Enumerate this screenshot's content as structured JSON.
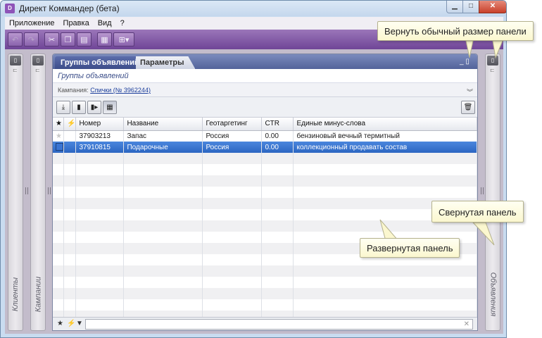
{
  "window": {
    "title": "Директ Коммандер (бета)",
    "app_icon_glyph": "D",
    "minimize": "▁",
    "maximize": "□",
    "close": "✕"
  },
  "menu": [
    "Приложение",
    "Правка",
    "Вид",
    "?"
  ],
  "toolbar": {
    "buttons": [
      {
        "icon": "undo-icon",
        "glyph": "↶",
        "enabled": false
      },
      {
        "icon": "redo-icon",
        "glyph": "↷",
        "enabled": false
      },
      {
        "icon": "cut-icon",
        "glyph": "✂",
        "enabled": true
      },
      {
        "icon": "copy-icon",
        "glyph": "❐",
        "enabled": true
      },
      {
        "icon": "clipboard-icon",
        "glyph": "▤",
        "enabled": true
      },
      {
        "icon": "table-icon",
        "glyph": "▦",
        "enabled": true
      },
      {
        "icon": "layout-icon",
        "glyph": "⊞▾",
        "enabled": true
      }
    ]
  },
  "side_panels": {
    "clients": "Клиенты",
    "campaigns": "Кампании",
    "ads": "Объявления"
  },
  "panel": {
    "tabs": [
      "Группы объявлений",
      "Параметры"
    ],
    "subtitle": "Группы объявлений",
    "campaign_label": "Кампания:",
    "campaign_link": "Спички (№ 3962244)",
    "controls": "_ ▯"
  },
  "grid": {
    "columns": [
      "★",
      "⚡",
      "Номер",
      "Название",
      "Геотаргетинг",
      "CTR",
      "Единые минус-слова"
    ],
    "rows": [
      {
        "number": "37903213",
        "name": "Запас",
        "geo": "Россия",
        "ctr": "0.00",
        "minus_words": "бензиновый вечный термитный",
        "selected": false
      },
      {
        "number": "37910815",
        "name": "Подарочные",
        "geo": "Россия",
        "ctr": "0.00",
        "minus_words": "коллекционный продавать состав",
        "selected": true
      }
    ]
  },
  "filter": {
    "star": "★",
    "flag": "⚡",
    "funnel": "▼",
    "clear": "✕"
  },
  "callouts": {
    "restore": "Вернуть обычный размер панели",
    "collapsed": "Свернутая панель",
    "expanded": "Развернутая панель"
  },
  "colors": {
    "toolbar_purple": "#7e56a6",
    "tab_blue": "#4a5a98",
    "selection_blue": "#3572cf",
    "callout_bg": "#fdf9d8"
  }
}
